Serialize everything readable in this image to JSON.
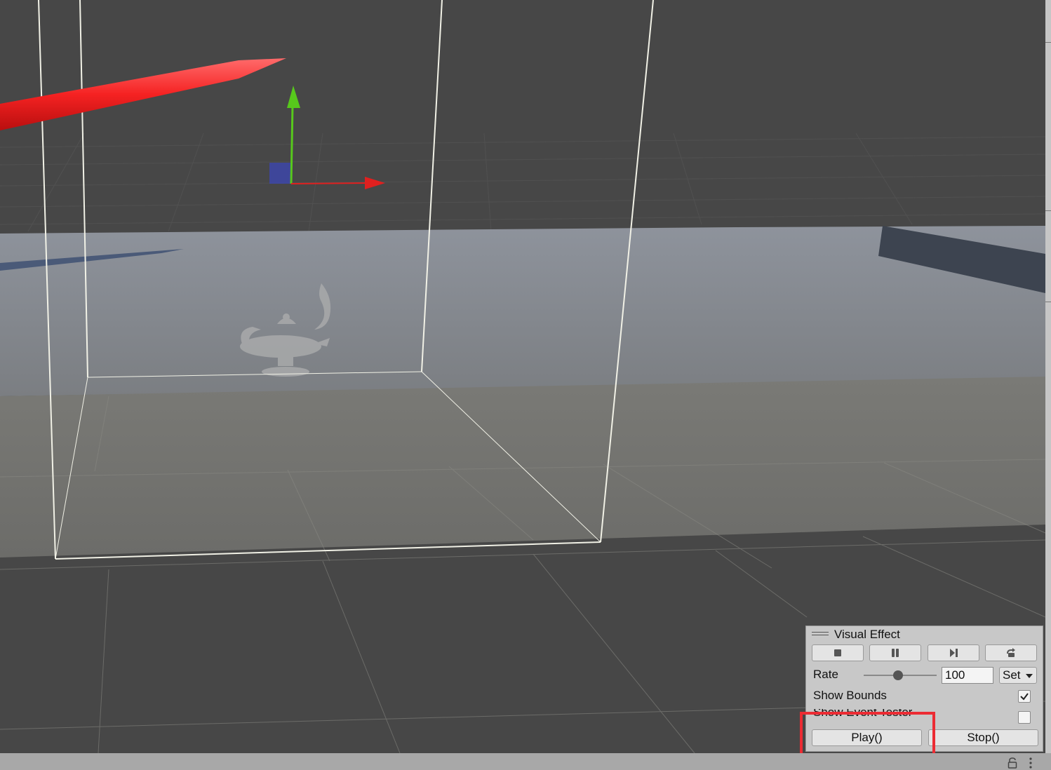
{
  "visual_effect_panel": {
    "title": "Visual Effect",
    "controls": [
      {
        "icon": "stop-icon"
      },
      {
        "icon": "pause-icon"
      },
      {
        "icon": "step-icon"
      },
      {
        "icon": "restart-icon"
      }
    ],
    "rate_label": "Rate",
    "rate_value": "100",
    "rate_slider_fraction": 0.47,
    "set_label": "Set",
    "show_bounds_label": "Show Bounds",
    "show_bounds_checked": true,
    "show_event_tester_label": "Show Event Tester",
    "show_event_tester_checked": false,
    "play_label": "Play()",
    "stop_label": "Stop()"
  },
  "highlight_color": "#ec2b33",
  "colors": {
    "viewport_bg": "#474747",
    "ground_plane": "#878c94",
    "gizmo_x": "#e0201f",
    "gizmo_y": "#57c81c",
    "gizmo_z": "#3b46b5"
  },
  "status_bar": {
    "icons": [
      "lock-icon",
      "more-options-icon"
    ]
  }
}
